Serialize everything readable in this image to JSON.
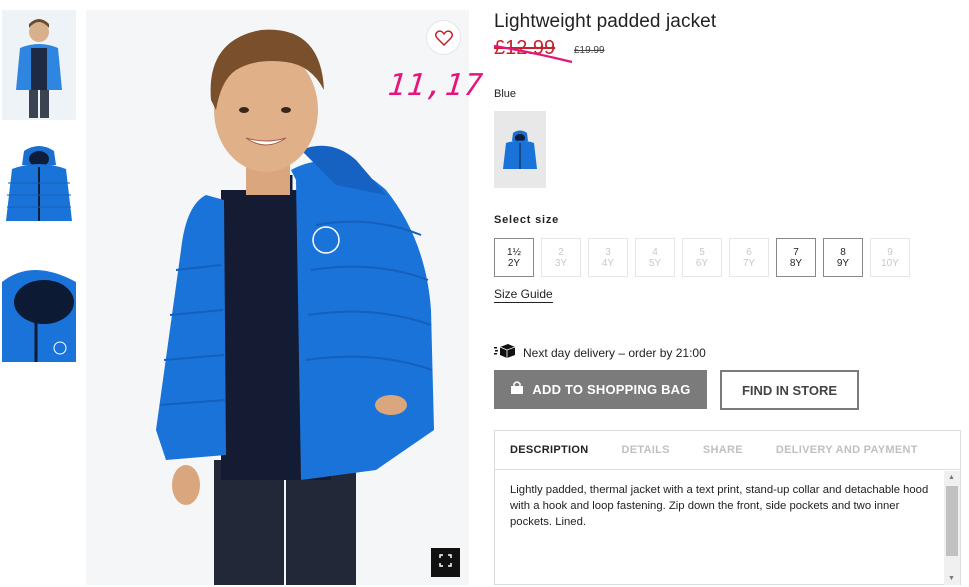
{
  "product": {
    "title": "Lightweight padded jacket",
    "price": "£12.99",
    "old_price": "£19.99",
    "handwritten_price": "11,17",
    "color_label": "Blue"
  },
  "sizes": {
    "label": "Select size",
    "options": [
      {
        "top": "1½",
        "bottom": "2Y",
        "available": true
      },
      {
        "top": "2",
        "bottom": "3Y",
        "available": false
      },
      {
        "top": "3",
        "bottom": "4Y",
        "available": false
      },
      {
        "top": "4",
        "bottom": "5Y",
        "available": false
      },
      {
        "top": "5",
        "bottom": "6Y",
        "available": false
      },
      {
        "top": "6",
        "bottom": "7Y",
        "available": false
      },
      {
        "top": "7",
        "bottom": "8Y",
        "available": true
      },
      {
        "top": "8",
        "bottom": "9Y",
        "available": true
      },
      {
        "top": "9",
        "bottom": "10Y",
        "available": false
      }
    ],
    "guide": "Size Guide"
  },
  "delivery": {
    "text": "Next day delivery – order by 21:00"
  },
  "buttons": {
    "add_to_bag": "ADD TO SHOPPING BAG",
    "find_in_store": "FIND IN STORE"
  },
  "tabs": [
    {
      "label": "DESCRIPTION",
      "active": true
    },
    {
      "label": "DETAILS",
      "active": false
    },
    {
      "label": "SHARE",
      "active": false
    },
    {
      "label": "DELIVERY AND PAYMENT",
      "active": false
    }
  ],
  "description": "Lightly padded, thermal jacket with a text print, stand-up collar and detachable hood with a hook and loop fastening. Zip down the front, side pockets and two inner pockets. Lined.",
  "colors": {
    "sale_red": "#c4222c",
    "handwriting_pink": "#e6157c",
    "jacket_blue": "#1a73d9",
    "button_grey": "#7b7b7b"
  },
  "icons": [
    "heart-icon",
    "fullscreen-icon",
    "shopping-bag-icon",
    "delivery-truck-icon"
  ]
}
